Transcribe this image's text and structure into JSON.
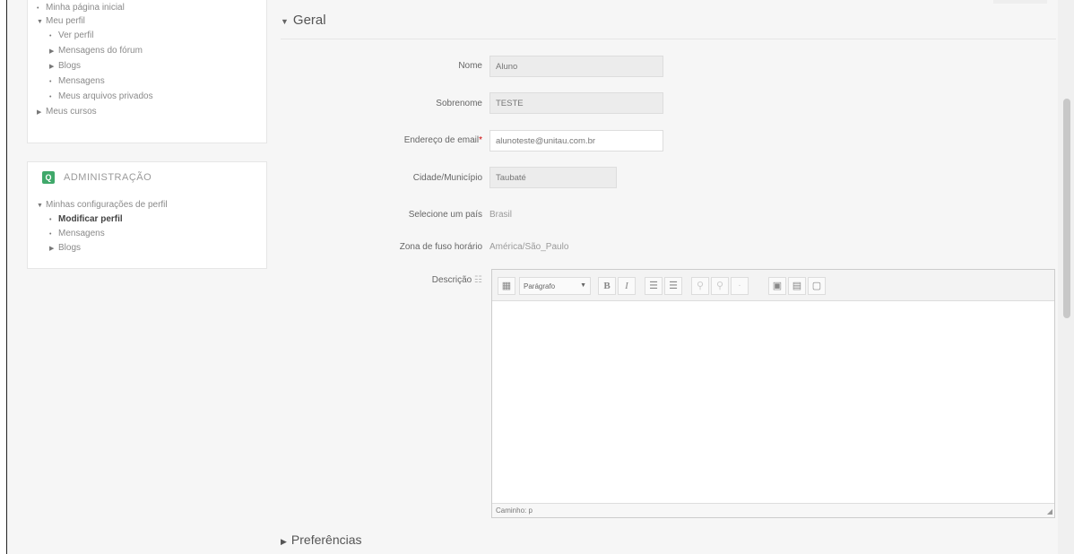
{
  "navigation": {
    "items": [
      {
        "label": "Minha página inicial",
        "mark": "•"
      },
      {
        "label": "Meu perfil",
        "mark": "▼"
      },
      {
        "label": "Ver perfil",
        "mark": "•"
      },
      {
        "label": "Mensagens do fórum",
        "mark": "▶"
      },
      {
        "label": "Blogs",
        "mark": "▶"
      },
      {
        "label": "Mensagens",
        "mark": "•"
      },
      {
        "label": "Meus arquivos privados",
        "mark": "•"
      },
      {
        "label": "Meus cursos",
        "mark": "▶"
      }
    ]
  },
  "admin": {
    "title": "ADMINISTRAÇÃO",
    "icon": "search-icon",
    "items": [
      {
        "label": "Minhas configurações de perfil",
        "mark": "▼"
      },
      {
        "label": "Modificar perfil",
        "mark": "•"
      },
      {
        "label": "Mensagens",
        "mark": "•"
      },
      {
        "label": "Blogs",
        "mark": "▶"
      }
    ]
  },
  "form": {
    "section_title": "Geral",
    "nome_label": "Nome",
    "nome_value": "Aluno",
    "sobrenome_label": "Sobrenome",
    "sobrenome_value": "TESTE",
    "email_label": "Endereço de email",
    "email_required": "*",
    "email_value": "alunoteste@unitau.com.br",
    "cidade_label": "Cidade/Município",
    "cidade_value": "Taubaté",
    "pais_label": "Selecione um país",
    "pais_value": "Brasil",
    "fuso_label": "Zona de fuso horário",
    "fuso_value": "América/São_Paulo",
    "descricao_label": "Descrição",
    "descricao_help_icon": "help-icon"
  },
  "editor": {
    "format_select": "Parágrafo",
    "bold": "B",
    "italic": "I",
    "status_path": "Caminho: p"
  },
  "collapsed_section": {
    "title": "Preferências"
  }
}
